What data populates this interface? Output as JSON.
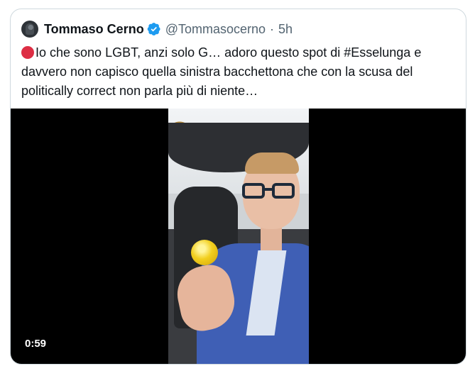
{
  "tweet": {
    "author_name": "Tommaso Cerno",
    "handle": "@Tommasocerno",
    "separator": "·",
    "time": "5h",
    "text": "Io che sono LGBT, anzi solo G… adoro questo spot di #Esselunga e davvero non capisco quella sinistra bacchettona che con la scusa del politically correct non parla più di niente…",
    "leading_emoji": "red-circle-icon"
  },
  "media": {
    "type": "video",
    "duration": "0:59"
  },
  "colors": {
    "verified_blue": "#1d9bf0",
    "handle_gray": "#536471",
    "border": "#cfd9de",
    "red_circle": "#dd2e44"
  }
}
